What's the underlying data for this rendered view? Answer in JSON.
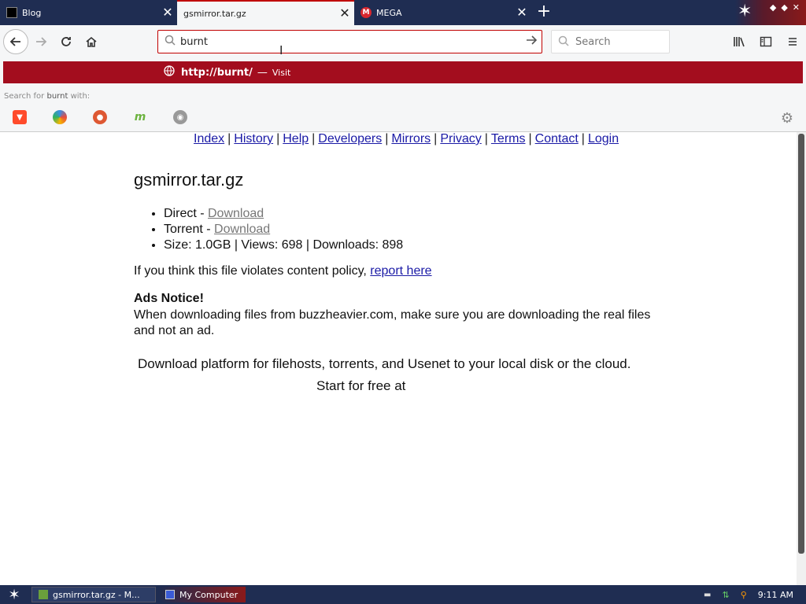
{
  "tabs": [
    {
      "title": "Blog",
      "favicon": "blog-favicon"
    },
    {
      "title": "gsmirror.tar.gz",
      "favicon": "none",
      "active": true
    },
    {
      "title": "MEGA",
      "favicon": "mega-favicon"
    }
  ],
  "tabbar": {
    "new_tab": "+",
    "close": "✕"
  },
  "navbar": {
    "url_value": "burnt",
    "search_placeholder": "Search"
  },
  "dropdown": {
    "proto": "http://",
    "host": "burnt/",
    "dash": "—",
    "visit": "Visit",
    "search_with_prefix": "Search for",
    "search_with_term": "burnt",
    "search_with_suffix": "with:"
  },
  "page": {
    "links": [
      "Index",
      "History",
      "Help",
      "Developers",
      "Mirrors",
      "Privacy",
      "Terms",
      "Contact",
      "Login"
    ],
    "filename": "gsmirror.tar.gz",
    "direct_label": "Direct - ",
    "torrent_label": "Torrent - ",
    "download_link": "Download",
    "size_line": "Size: 1.0GB | Views: 698 | Downloads: 898",
    "policy_text": "If you think this file violates content policy, ",
    "report_link": "report here",
    "ads_title": "Ads Notice!",
    "ads_text": "When downloading files from buzzheavier.com, make sure you are downloading the real files and not an ad.",
    "promo": "Download platform for filehosts, torrents, and Usenet to your local disk or the cloud.",
    "promo2": "Start for free at"
  },
  "taskbar": {
    "task1": "gsmirror.tar.gz - M...",
    "task2": "My Computer",
    "clock": "9:11 AM"
  },
  "colors": {
    "accent": "#a30d1e",
    "tabbar": "#1f2d52",
    "link": "#1a1aa6"
  }
}
